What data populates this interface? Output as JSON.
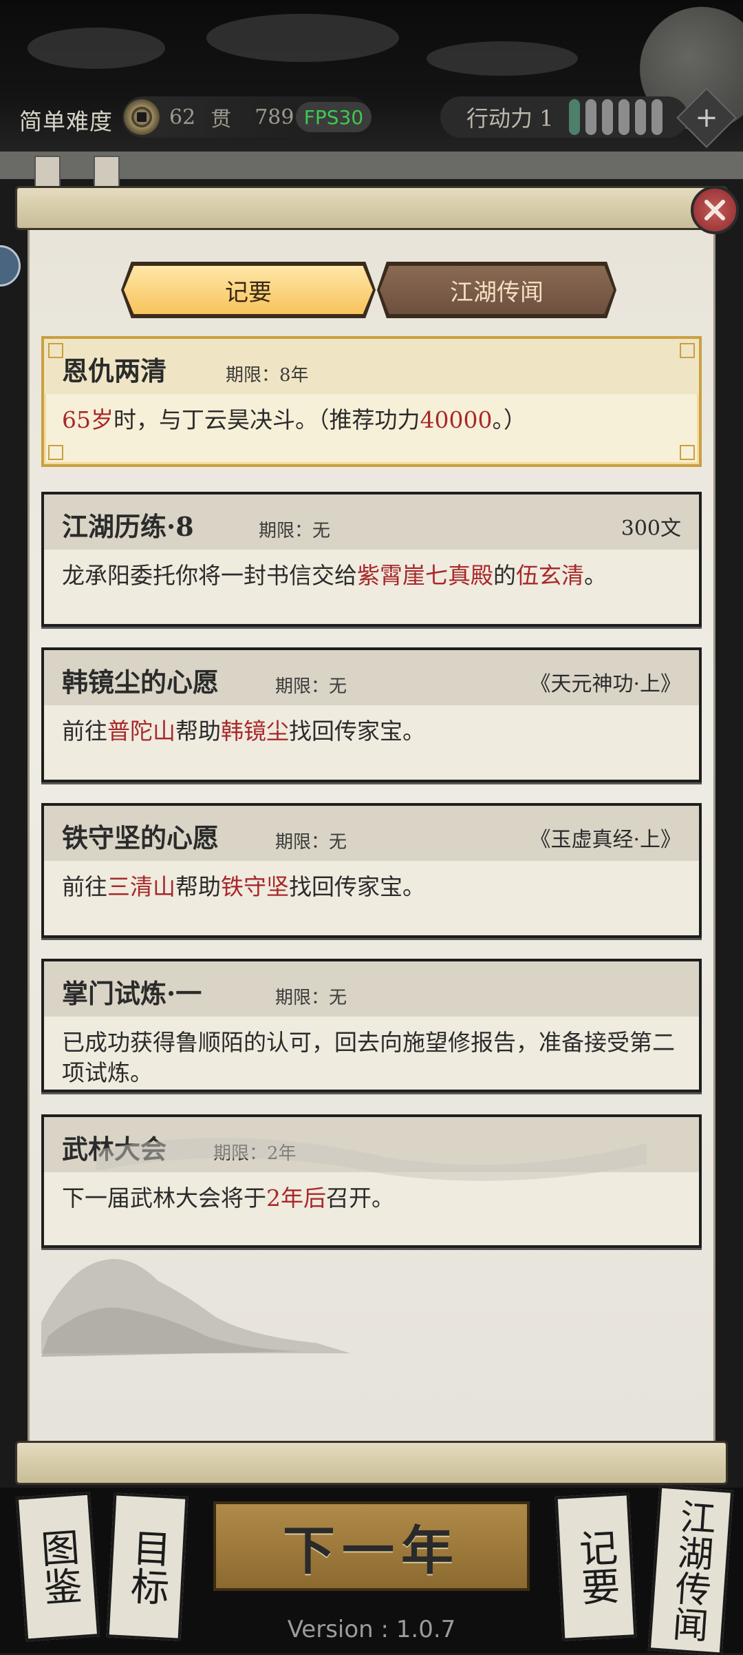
{
  "hud": {
    "difficulty": "简单难度",
    "coin_strings": "62",
    "coin_unit": "贯",
    "coin_wen": "789",
    "fps": "FPS30",
    "action_label": "行动力 1",
    "action_pips_total": 6,
    "action_pips_filled": 1,
    "plus_icon": "plus-icon"
  },
  "tabs": [
    {
      "label": "记要",
      "active": true
    },
    {
      "label": "江湖传闻",
      "active": false
    }
  ],
  "quests": [
    {
      "title": "恩仇两清",
      "deadline": "期限：8年",
      "reward": "",
      "body": [
        {
          "text": "65岁",
          "red": true
        },
        {
          "text": "时，与丁云昊决斗。（推荐功力",
          "red": false
        },
        {
          "text": "40000",
          "red": true
        },
        {
          "text": "。）",
          "red": false
        }
      ]
    },
    {
      "title": "江湖历练·8",
      "deadline": "期限：无",
      "reward": "300文",
      "body": [
        {
          "text": "龙承阳委托你将一封书信交给",
          "red": false
        },
        {
          "text": "紫霄崖七真殿",
          "red": true
        },
        {
          "text": "的",
          "red": false
        },
        {
          "text": "伍玄清",
          "red": true
        },
        {
          "text": "。",
          "red": false
        }
      ]
    },
    {
      "title": "韩镜尘的心愿",
      "deadline": "期限：无",
      "reward": "《天元神功·上》",
      "body": [
        {
          "text": "前往",
          "red": false
        },
        {
          "text": "普陀山",
          "red": true
        },
        {
          "text": "帮助",
          "red": false
        },
        {
          "text": "韩镜尘",
          "red": true
        },
        {
          "text": "找回传家宝。",
          "red": false
        }
      ]
    },
    {
      "title": "铁守坚的心愿",
      "deadline": "期限：无",
      "reward": "《玉虚真经·上》",
      "body": [
        {
          "text": "前往",
          "red": false
        },
        {
          "text": "三清山",
          "red": true
        },
        {
          "text": "帮助",
          "red": false
        },
        {
          "text": "铁守坚",
          "red": true
        },
        {
          "text": "找回传家宝。",
          "red": false
        }
      ]
    },
    {
      "title": "掌门试炼·一",
      "deadline": "期限：无",
      "reward": "",
      "body": [
        {
          "text": "已成功获得鲁顺陌的认可，回去向施望修报告，准备接受第二项试炼。",
          "red": false
        }
      ]
    },
    {
      "title": "武林大会",
      "deadline": "期限：2年",
      "reward": "",
      "body": [
        {
          "text": "下一届武林大会将于",
          "red": false
        },
        {
          "text": "2年后",
          "red": true
        },
        {
          "text": "召开。",
          "red": false
        }
      ]
    }
  ],
  "bottom": {
    "left_buttons": [
      "图鉴",
      "目标"
    ],
    "next_year": "下一年",
    "right_buttons": [
      "记要",
      "江湖传闻"
    ],
    "version": "Version : 1.0.7"
  },
  "colors": {
    "highlight_red": "#a8282a",
    "tab_active": "#f7c35c",
    "tab_inactive": "#6e5040",
    "fps_green": "#3ec94f"
  }
}
